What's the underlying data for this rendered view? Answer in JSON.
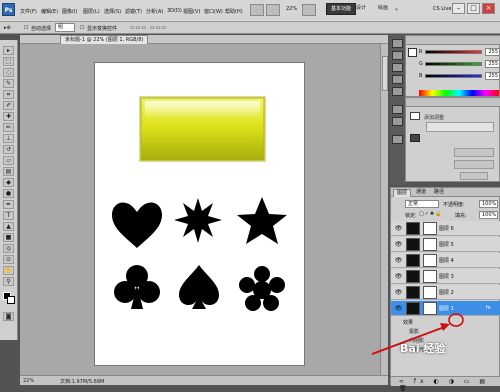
{
  "menubar": {
    "logo": "Ps",
    "menus": [
      "文件(F)",
      "编辑(E)",
      "图像(I)",
      "图层(L)",
      "选择(S)",
      "滤镜(T)",
      "分析(A)",
      "3D(D)",
      "视图(V)",
      "窗口(W)",
      "帮助(H)"
    ],
    "zoom": "22%",
    "workspace_active": "基本功能",
    "workspace_items": [
      "设计",
      "绘画"
    ],
    "cs_live": "CS Live",
    "window_buttons": [
      "–",
      "□",
      "×"
    ]
  },
  "options": {
    "auto_select_label": "自动选择",
    "auto_select_value": "组",
    "show_transform_label": "显示变换控件"
  },
  "document": {
    "tab_title": "未标题-1 @ 22% (图层 1, RGB/8)",
    "status_zoom": "22%",
    "status_doc": "文档:1.97M/5.69M"
  },
  "color_panel": {
    "channels": [
      {
        "label": "R",
        "value": "255",
        "gradient": "#ff2b2b"
      },
      {
        "label": "G",
        "value": "255",
        "gradient": "#2bb52b"
      },
      {
        "label": "B",
        "value": "255",
        "gradient": "#2b2bff"
      }
    ]
  },
  "adjustments_panel": {
    "item_label": "添加调整",
    "buttons": [
      "",
      ""
    ]
  },
  "layers_panel": {
    "tabs": [
      "图层",
      "通道",
      "路径"
    ],
    "blend_mode": "正常",
    "opacity_label": "不透明度:",
    "opacity_value": "100%",
    "lock_label": "锁定:",
    "fill_label": "填充:",
    "fill_value": "100%",
    "layers": [
      "图层 6",
      "图层 5",
      "图层 4",
      "图层 3",
      "图层 2",
      "图层 1"
    ],
    "selected_index": 5,
    "effects": [
      "效果",
      "投影",
      "内阴影",
      "外发光"
    ]
  },
  "colors": {
    "selected_layer": "#3d8ee6",
    "accent_red": "#cc1111",
    "yellow_button": "#d9e019"
  },
  "watermark": "Bai 经验"
}
